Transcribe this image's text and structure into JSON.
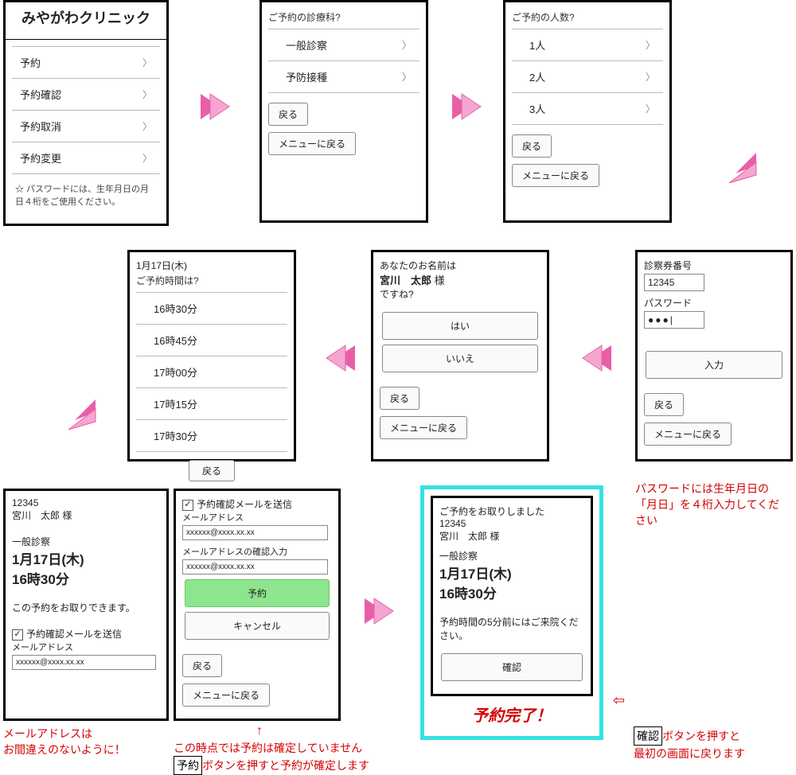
{
  "panel1": {
    "title": "みやがわクリニック",
    "items": [
      "予約",
      "予約確認",
      "予約取消",
      "予約変更"
    ],
    "note": "☆ パスワードには、生年月日の月日４桁をご使用ください。"
  },
  "panel2": {
    "q": "ご予約の診療科?",
    "items": [
      "一般診察",
      "予防接種"
    ],
    "back": "戻る",
    "menu": "メニューに戻る"
  },
  "panel3": {
    "q": "ご予約の人数?",
    "items": [
      "1人",
      "2人",
      "3人"
    ],
    "back": "戻る",
    "menu": "メニューに戻る"
  },
  "panel4": {
    "l1": "診察券番号",
    "v1": "12345",
    "l2": "パスワード",
    "v2": "●●●|",
    "enter": "入力",
    "back": "戻る",
    "menu": "メニューに戻る"
  },
  "panel5": {
    "l1": "あなたのお名前は",
    "name": "宮川　太郎",
    "suffix": " 様",
    "l2": "ですね?",
    "yes": "はい",
    "no": "いいえ",
    "back": "戻る",
    "menu": "メニューに戻る"
  },
  "panel6": {
    "date": "1月17日(木)",
    "q": "ご予約時間は?",
    "items": [
      "16時30分",
      "16時45分",
      "17時00分",
      "17時15分",
      "17時30分"
    ],
    "back": "戻る"
  },
  "panel7": {
    "id": "12345",
    "name": "宮川　太郎 様",
    "dept": "一般診察",
    "date": "1月17日(木)",
    "time": "16時30分",
    "msg": "この予約をお取りできます。",
    "cb": "予約確認メールを送信",
    "ml": "メールアドレス",
    "mv": "xxxxxx@xxxx.xx.xx"
  },
  "panel8": {
    "cb": "予約確認メールを送信",
    "ml": "メールアドレス",
    "mv": "xxxxxx@xxxx.xx.xx",
    "ml2": "メールアドレスの確認入力",
    "mv2": "xxxxxx@xxxx.xx.xx",
    "reserve": "予約",
    "cancel": "キャンセル",
    "back": "戻る",
    "menu": "メニューに戻る"
  },
  "panel9": {
    "head": "ご予約をお取りしました",
    "id": "12345",
    "name": "宮川　太郎 様",
    "dept": "一般診察",
    "date": "1月17日(木)",
    "time": "16時30分",
    "msg": "予約時間の5分前にはご来院ください。",
    "ok": "確認",
    "banner": "予約完了！"
  },
  "caps": {
    "c1": "メールアドレスは\nお間違えのないように！",
    "c2a": "この時点では予約は確定していません",
    "c2b_box": "予約",
    "c2b_rest": "ボタンを押すと予約が確定します",
    "c3": "パスワードには生年月日の「月日」を４桁入力してください",
    "c4_box": "確認",
    "c4_rest": "ボタンを押すと\n最初の画面に戻ります",
    "up": "↑",
    "ret": "⇦"
  }
}
